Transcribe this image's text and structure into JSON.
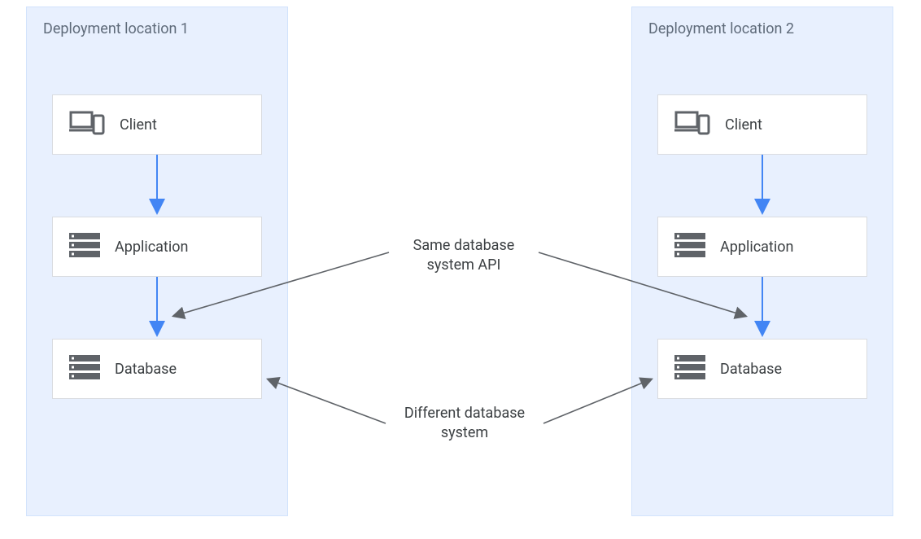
{
  "containers": {
    "left": {
      "title": "Deployment location 1"
    },
    "right": {
      "title": "Deployment location 2"
    }
  },
  "nodes": {
    "left": {
      "client": {
        "label": "Client"
      },
      "application": {
        "label": "Application"
      },
      "database": {
        "label": "Database"
      }
    },
    "right": {
      "client": {
        "label": "Client"
      },
      "application": {
        "label": "Application"
      },
      "database": {
        "label": "Database"
      }
    }
  },
  "annotations": {
    "same_api": {
      "text_line1": "Same database",
      "text_line2": "system API"
    },
    "diff_system": {
      "text_line1": "Different database",
      "text_line2": "system"
    }
  },
  "colors": {
    "container_bg": "#e8f0fe",
    "arrow_blue": "#4285f4",
    "arrow_grey": "#5f6368"
  }
}
